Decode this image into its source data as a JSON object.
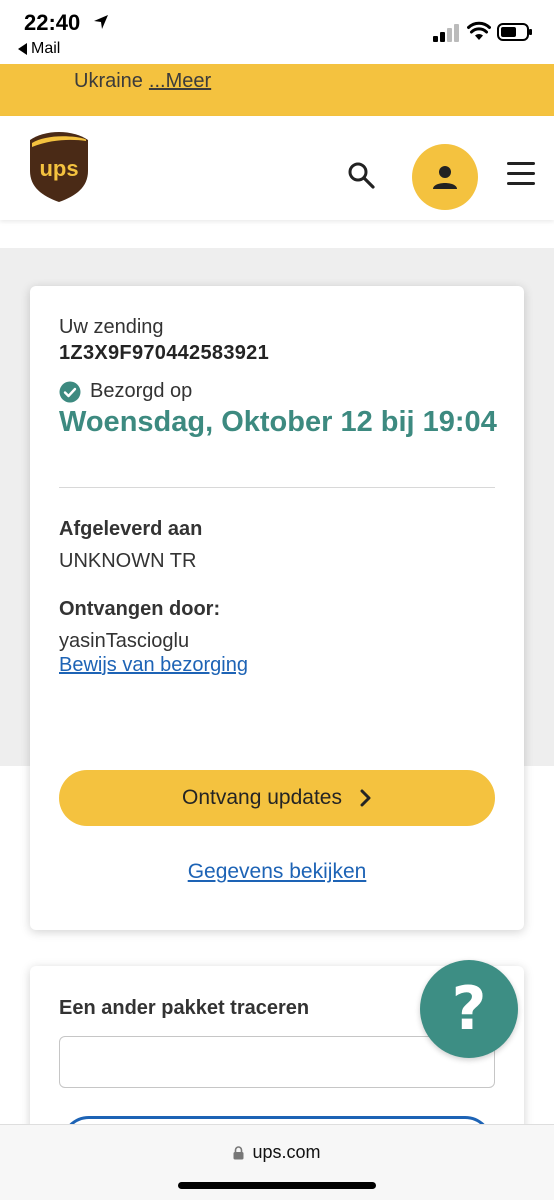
{
  "status_bar": {
    "time": "22:40",
    "back_label": "Mail"
  },
  "banner": {
    "text": "Ukraine",
    "more_link": "...Meer"
  },
  "header": {
    "logo_icon": "ups-shield-logo",
    "search_icon": "search-icon",
    "account_icon": "person-icon",
    "menu_icon": "hamburger-menu-icon"
  },
  "shipment": {
    "label": "Uw zending",
    "tracking_number": "1Z3X9F970442583921",
    "status_label": "Bezorgd op",
    "delivered_date": "Woensdag, Oktober 12 bij 19:04",
    "delivered_to_label": "Afgeleverd aan",
    "delivered_to": "UNKNOWN TR",
    "received_by_label": "Ontvangen door:",
    "received_by": "yasinTascioglu",
    "proof_link": "Bewijs van bezorging",
    "updates_button": "Ontvang updates",
    "details_link": "Gegevens bekijken"
  },
  "track_another": {
    "title": "Een ander pakket traceren",
    "input_value": ""
  },
  "help": {
    "label": "?"
  },
  "browser": {
    "url": "ups.com"
  },
  "colors": {
    "brand_yellow": "#f4c23f",
    "accent_teal": "#3d8a80",
    "link_blue": "#1d63b5",
    "ups_brown": "#4a2a16"
  }
}
